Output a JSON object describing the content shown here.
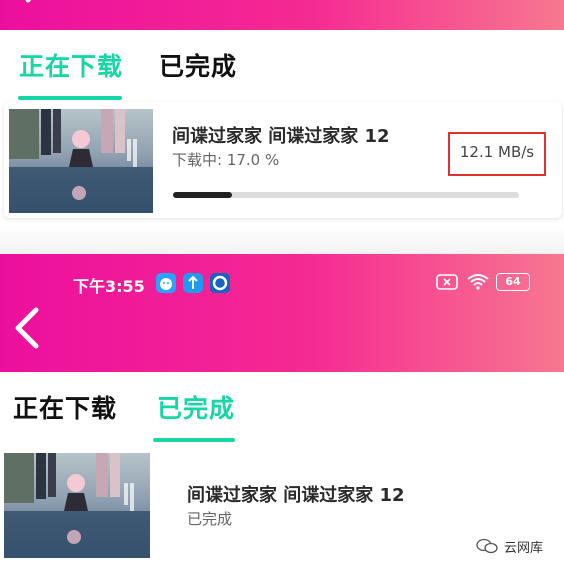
{
  "colors": {
    "accent": "#17d6a6",
    "header_gradient_start": "#ec0f9e",
    "header_gradient_end": "#f7788f",
    "highlight_box": "#e03030"
  },
  "top_panel": {
    "tabs": [
      {
        "label": "正在下载",
        "active": true
      },
      {
        "label": "已完成",
        "active": false
      }
    ],
    "item": {
      "title": "间谍过家家 间谍过家家 12",
      "status": "下载中: 17.0 %",
      "speed": "12.1 MB/s",
      "progress": 0.17
    }
  },
  "bottom_panel": {
    "status_bar": {
      "time": "下午3:55",
      "battery": "64",
      "app_icons": [
        "cat-app-icon",
        "upload-app-icon",
        "browser-app-icon"
      ]
    },
    "tabs": [
      {
        "label": "正在下载",
        "active": false
      },
      {
        "label": "已完成",
        "active": true
      }
    ],
    "item": {
      "title": "间谍过家家 间谍过家家 12",
      "status": "已完成"
    }
  },
  "watermark": {
    "text": "云网库",
    "icon": "wechat-icon"
  }
}
